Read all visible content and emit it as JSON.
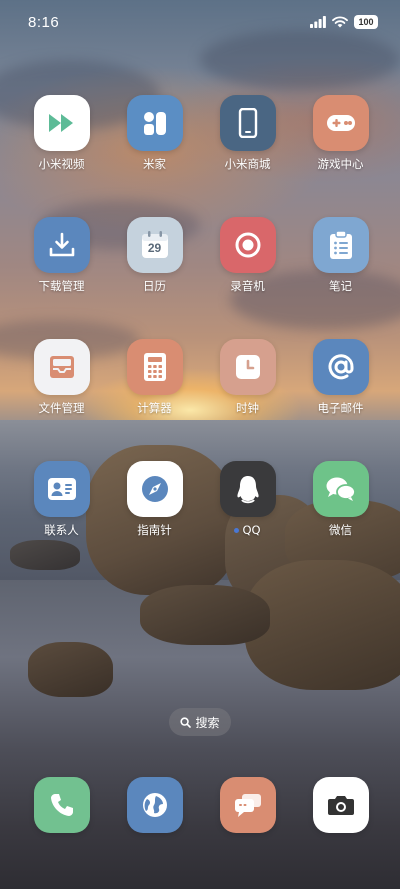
{
  "status_bar": {
    "time": "8:16",
    "battery": "100"
  },
  "apps": [
    {
      "label": "小米视频",
      "icon": "play-icon",
      "bg": "#ffffff",
      "fg": "#5dbb97"
    },
    {
      "label": "米家",
      "icon": "mijia-icon",
      "bg": "#5b8ec4",
      "fg": "#ffffff"
    },
    {
      "label": "小米商城",
      "icon": "phone-device-icon",
      "bg": "#4a6683",
      "fg": "#ffffff"
    },
    {
      "label": "游戏中心",
      "icon": "gamepad-icon",
      "bg": "#d98d72",
      "fg": "#ffffff"
    },
    {
      "label": "下载管理",
      "icon": "download-icon",
      "bg": "#5b87bd",
      "fg": "#ffffff"
    },
    {
      "label": "日历",
      "icon": "calendar-icon",
      "bg": "#c5d2dd",
      "fg": "#5a6a7a",
      "calendar_day": "29"
    },
    {
      "label": "录音机",
      "icon": "record-icon",
      "bg": "#d9676a",
      "fg": "#ffffff"
    },
    {
      "label": "笔记",
      "icon": "clipboard-icon",
      "bg": "#7fa7d1",
      "fg": "#ffffff"
    },
    {
      "label": "文件管理",
      "icon": "inbox-icon",
      "bg": "#f2f2f4",
      "fg": "#d98d72"
    },
    {
      "label": "计算器",
      "icon": "calculator-icon",
      "bg": "#d98d72",
      "fg": "#ffffff"
    },
    {
      "label": "时钟",
      "icon": "clock-icon",
      "bg": "#d6a08e",
      "fg": "#ffffff"
    },
    {
      "label": "电子邮件",
      "icon": "at-sign-icon",
      "bg": "#5b87bd",
      "fg": "#ffffff"
    },
    {
      "label": "联系人",
      "icon": "contact-card-icon",
      "bg": "#5b87bd",
      "fg": "#ffffff"
    },
    {
      "label": "指南针",
      "icon": "compass-icon",
      "bg": "#ffffff",
      "fg": "#5b87bd"
    },
    {
      "label": "QQ",
      "icon": "qq-penguin-icon",
      "bg": "#3a3a3c",
      "fg": "#ffffff",
      "dot_color": "#4a78d4"
    },
    {
      "label": "微信",
      "icon": "chat-bubbles-icon",
      "bg": "#6ec389",
      "fg": "#ffffff"
    }
  ],
  "search": {
    "label": "搜索"
  },
  "dock": [
    {
      "name": "phone",
      "icon": "phone-icon",
      "bg": "#72c190",
      "fg": "#ffffff"
    },
    {
      "name": "browser",
      "icon": "globe-icon",
      "bg": "#5b87bd",
      "fg": "#ffffff"
    },
    {
      "name": "messages",
      "icon": "message-icon",
      "bg": "#d98d72",
      "fg": "#ffffff"
    },
    {
      "name": "camera",
      "icon": "camera-icon",
      "bg": "#ffffff",
      "fg": "#333333"
    }
  ]
}
